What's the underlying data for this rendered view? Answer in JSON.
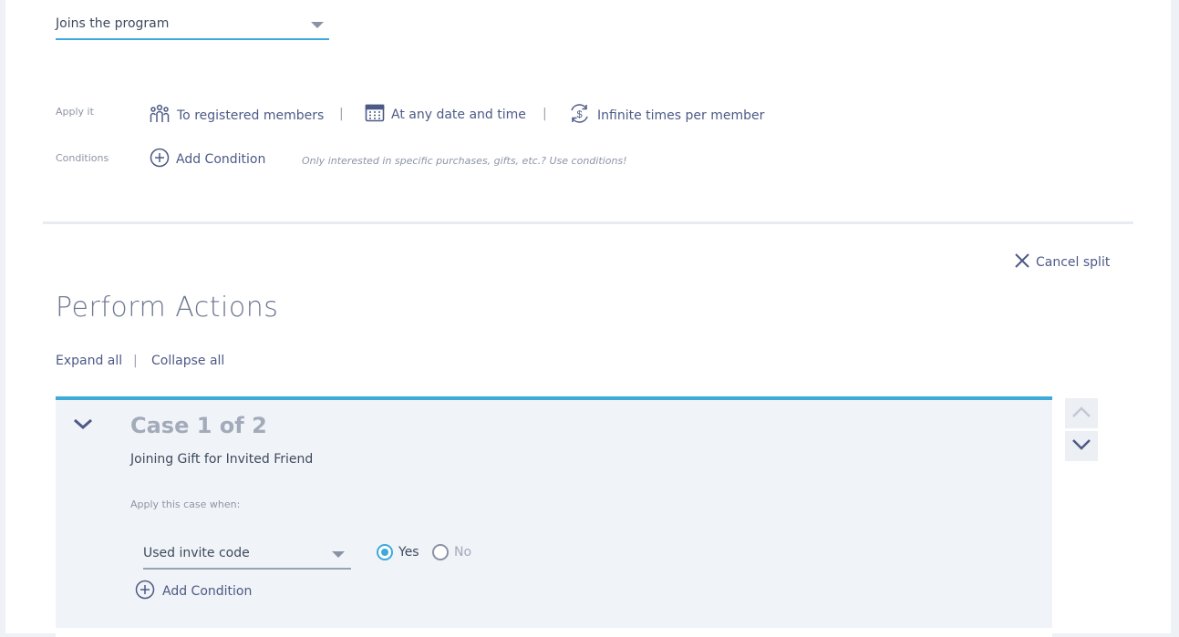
{
  "trigger": {
    "selected": "Joins the program"
  },
  "apply_it": {
    "label": "Apply it",
    "members": "To registered members",
    "schedule": "At any date and time",
    "frequency": "Infinite times per member",
    "separator": "|"
  },
  "conditions": {
    "label": "Conditions",
    "add_label": "Add Condition",
    "hint": "Only interested in specific purchases, gifts, etc.? Use conditions!"
  },
  "split": {
    "cancel_label": "Cancel split"
  },
  "actions": {
    "title": "Perform Actions",
    "expand_all": "Expand all",
    "collapse_all": "Collapse all",
    "separator": "|"
  },
  "case": {
    "title": "Case 1 of 2",
    "name": "Joining Gift for Invited Friend",
    "apply_when_label": "Apply this case when:",
    "condition": {
      "selected": "Used invite code",
      "options": [
        "Yes",
        "No"
      ],
      "value": "Yes"
    },
    "add_condition_label": "Add Condition"
  },
  "colors": {
    "accent": "#3fa9d8",
    "link": "#4d5a86",
    "muted": "#8d95a5",
    "panel": "#f0f3f7"
  },
  "icons": {
    "members": "people-icon",
    "schedule": "calendar-icon",
    "frequency": "refresh-dollar-icon",
    "add": "plus-circle-icon",
    "cancel": "close-icon",
    "toggle": "chevron-down-icon",
    "move_up": "chevron-up-icon",
    "move_down": "chevron-down-icon"
  }
}
